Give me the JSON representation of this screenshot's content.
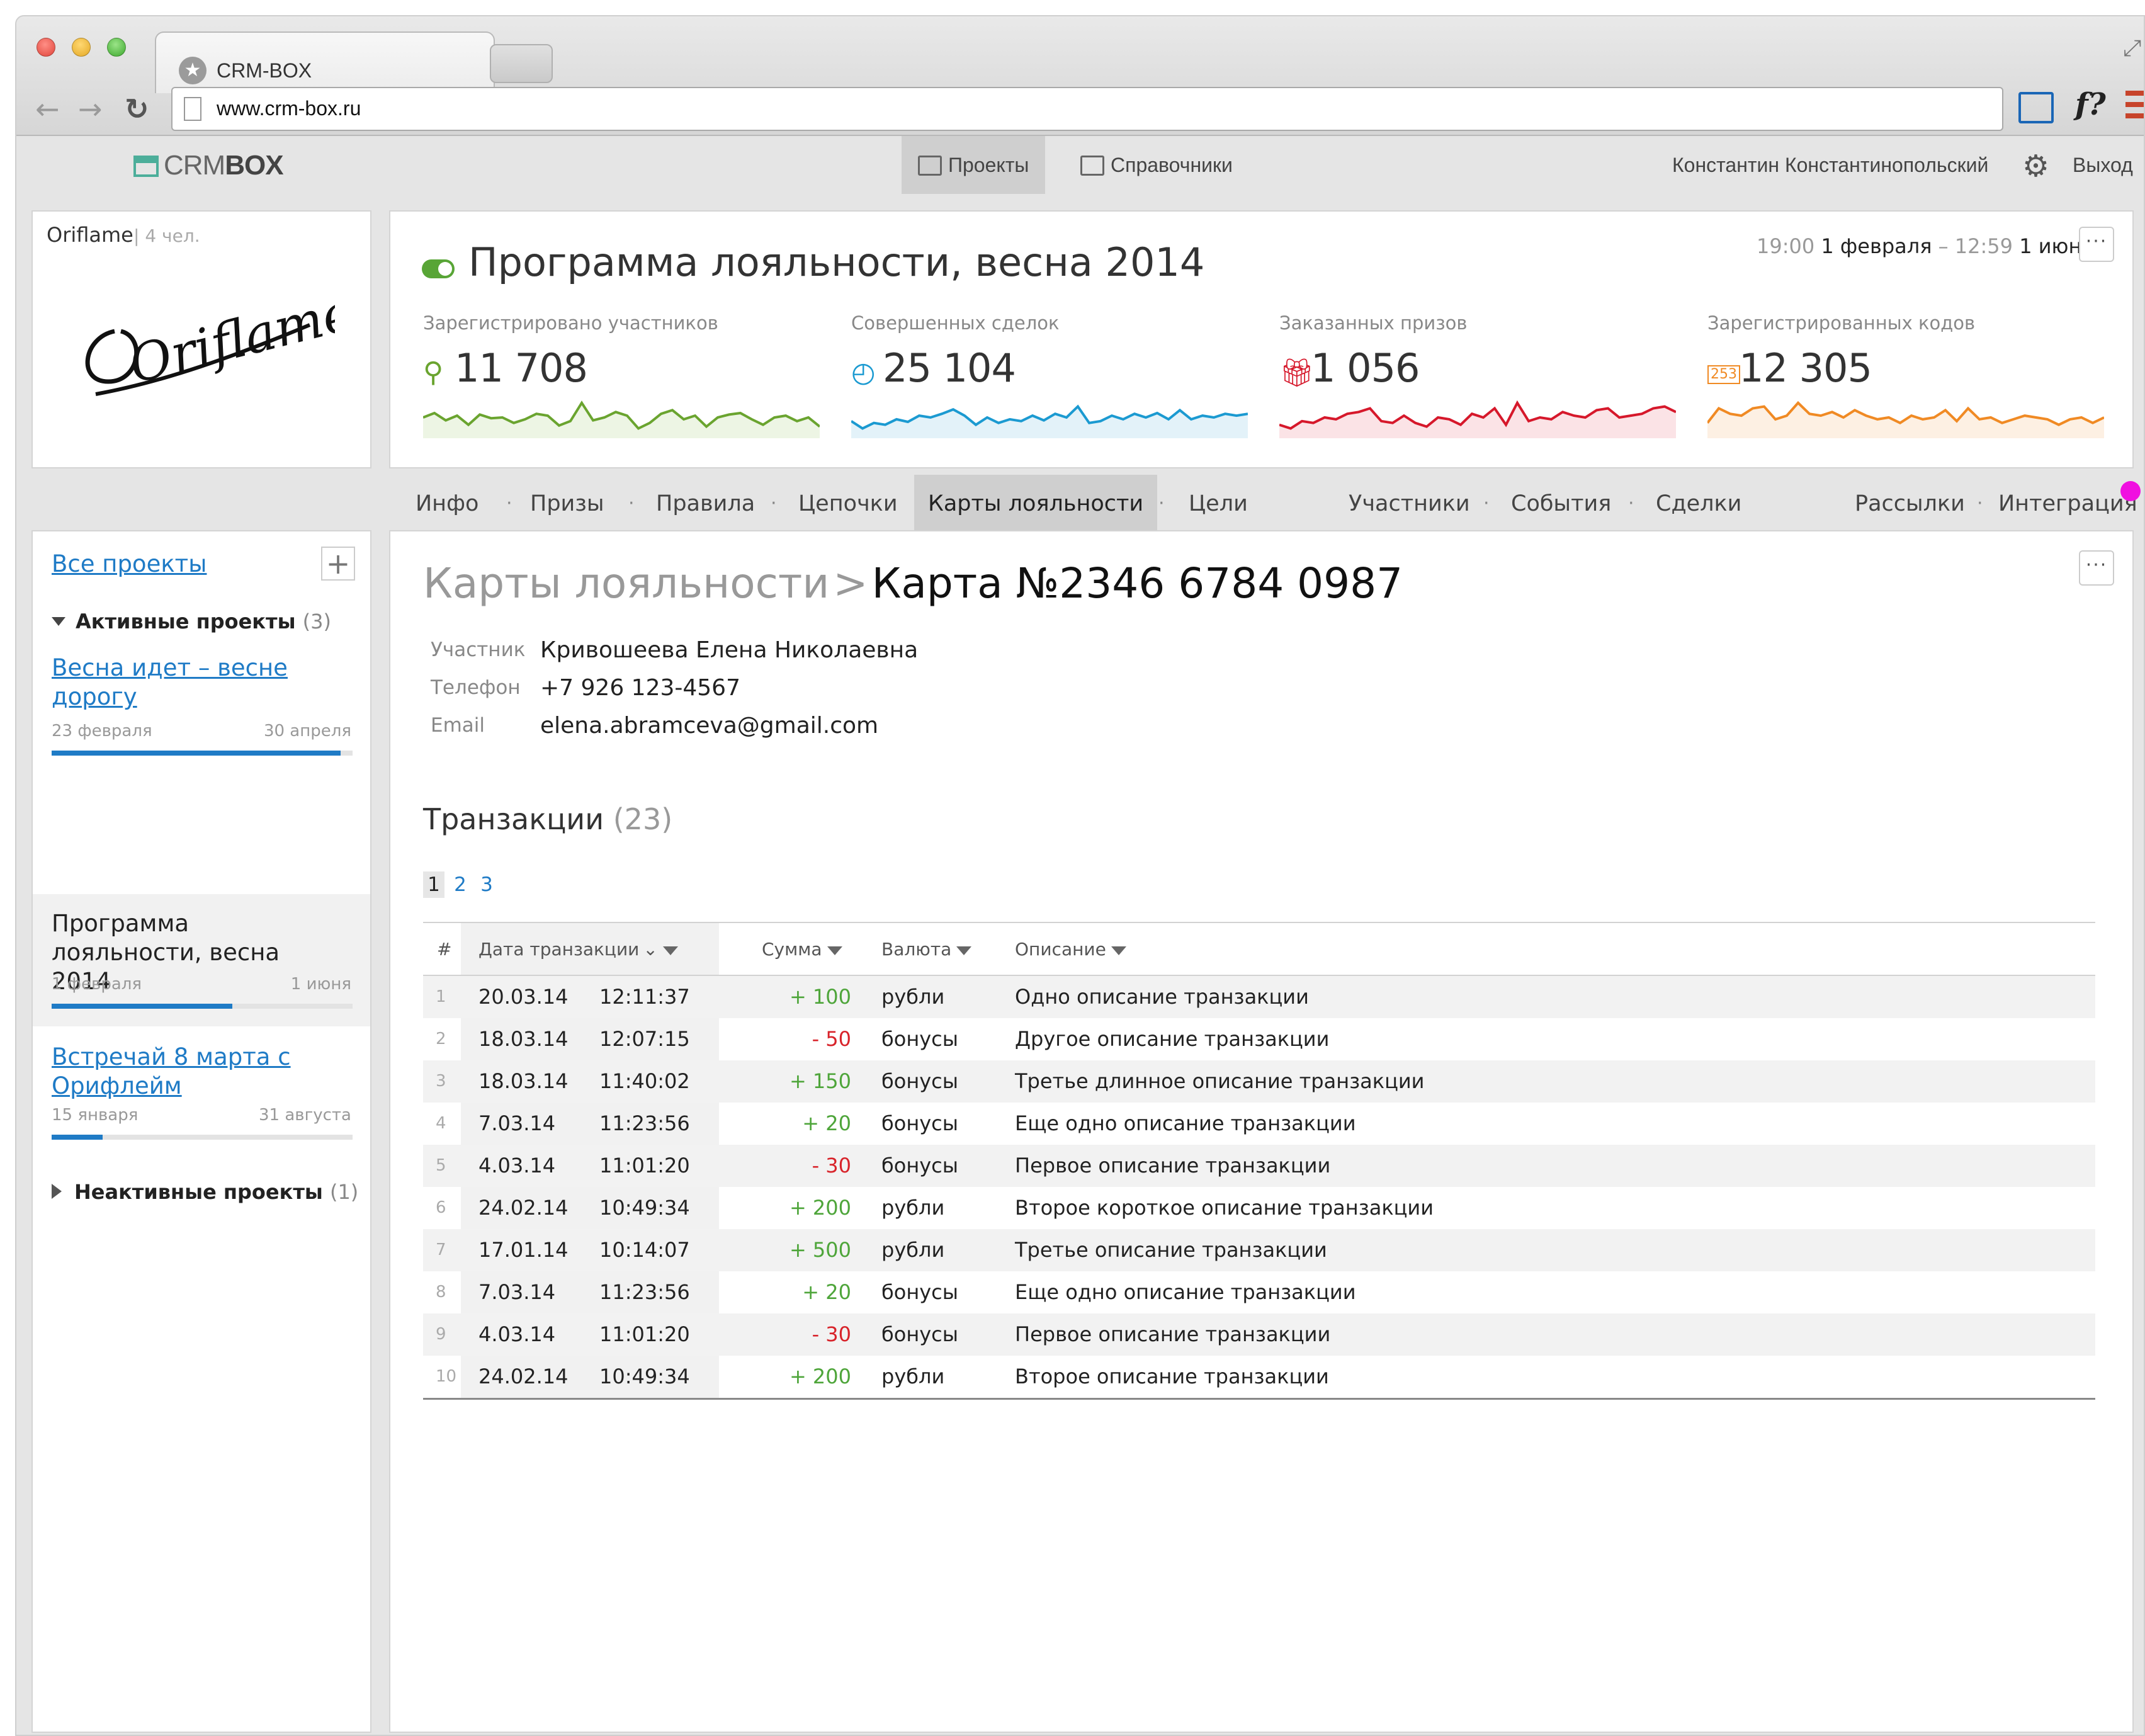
{
  "browser": {
    "tab_title": "CRM-BOX",
    "url": "www.crm-box.ru"
  },
  "appbar": {
    "logo_light": "CRM",
    "logo_bold": "BOX",
    "nav_projects": "Проекты",
    "nav_refs": "Справочники",
    "user_name": "Константин Константинопольский",
    "logout": "Выход"
  },
  "company": {
    "name": "Oriflame",
    "size": "| 4 чел.",
    "logo_text": "Oriflame"
  },
  "project": {
    "title": "Программа лояльности, весна 2014",
    "date_start_time": "19:00",
    "date_start": "1 февраля",
    "date_dash": "–",
    "date_end_time": "12:59",
    "date_end": "1 июня",
    "more": "···",
    "stats": [
      {
        "label": "Зарегистрировано участников",
        "value": "11 708",
        "icon": "user-icon",
        "color": "#6aa42f",
        "fill": "#edf5e4",
        "trend": [
          0.5,
          0.62,
          0.42,
          0.55,
          0.3,
          0.58,
          0.48,
          0.5,
          0.35,
          0.45,
          0.6,
          0.55,
          0.28,
          0.4,
          0.9,
          0.42,
          0.5,
          0.65,
          0.55,
          0.2,
          0.35,
          0.6,
          0.7,
          0.45,
          0.55,
          0.25,
          0.5,
          0.58,
          0.62,
          0.45,
          0.3,
          0.5,
          0.55,
          0.4,
          0.5,
          0.25
        ]
      },
      {
        "label": "Совершенных сделок",
        "value": "25 104",
        "icon": "clock-icon",
        "color": "#1b9ad1",
        "fill": "#e3f2f9",
        "trend": [
          0.4,
          0.2,
          0.35,
          0.3,
          0.45,
          0.38,
          0.55,
          0.5,
          0.6,
          0.72,
          0.55,
          0.3,
          0.5,
          0.35,
          0.45,
          0.4,
          0.55,
          0.42,
          0.6,
          0.5,
          0.8,
          0.35,
          0.4,
          0.55,
          0.45,
          0.6,
          0.5,
          0.62,
          0.45,
          0.7,
          0.45,
          0.55,
          0.5,
          0.6,
          0.55,
          0.6
        ]
      },
      {
        "label": "Заказанных призов",
        "value": "1 056",
        "icon": "gift-icon",
        "color": "#d6182b",
        "fill": "#fbe3e6",
        "trend": [
          0.3,
          0.2,
          0.4,
          0.35,
          0.5,
          0.45,
          0.6,
          0.65,
          0.75,
          0.4,
          0.35,
          0.55,
          0.35,
          0.25,
          0.5,
          0.45,
          0.3,
          0.6,
          0.5,
          0.75,
          0.3,
          0.9,
          0.4,
          0.5,
          0.45,
          0.65,
          0.55,
          0.5,
          0.7,
          0.75,
          0.5,
          0.55,
          0.6,
          0.75,
          0.8,
          0.65
        ]
      },
      {
        "label": "Зарегистрированных кодов",
        "value": "12 305",
        "icon": "code-icon",
        "color": "#f08a24",
        "fill": "#fdf0e3",
        "trend": [
          0.35,
          0.75,
          0.6,
          0.55,
          0.75,
          0.8,
          0.45,
          0.55,
          0.9,
          0.6,
          0.55,
          0.65,
          0.5,
          0.7,
          0.55,
          0.45,
          0.5,
          0.35,
          0.55,
          0.45,
          0.5,
          0.7,
          0.4,
          0.75,
          0.45,
          0.5,
          0.35,
          0.45,
          0.55,
          0.5,
          0.45,
          0.3,
          0.45,
          0.5,
          0.35,
          0.5
        ]
      }
    ]
  },
  "subnav": {
    "items": [
      "Инфо",
      "Призы",
      "Правила",
      "Цепочки",
      "Карты лояльности",
      "Цели",
      "Участники",
      "События",
      "Сделки",
      "Рассылки",
      "Интеграция"
    ],
    "separator": "·",
    "active": "Карты лояльности"
  },
  "sidebar": {
    "all_projects": "Все проекты",
    "add": "+",
    "active_group": "Активные  проекты",
    "active_count": "(3)",
    "inactive_group": "Неактивные проекты",
    "inactive_count": "(1)",
    "projects": [
      {
        "name": "Весна идет – весне дорогу",
        "start": "23 февраля",
        "end": "30 апреля",
        "progress": 0.96,
        "current": false
      },
      {
        "name": "Программа лояльности, весна 2014",
        "start": "1 февраля",
        "end": "1 июня",
        "progress": 0.6,
        "current": true
      },
      {
        "name": "Встречай 8 марта с Орифлейм",
        "start": "15 января",
        "end": "31 августа",
        "progress": 0.17,
        "current": false
      }
    ]
  },
  "card": {
    "breadcrumb_parent": "Карты лояльности",
    "breadcrumb_sep": ">",
    "breadcrumb_current": "Карта №2346 6784 0987",
    "more": "···",
    "participant_label": "Участник",
    "participant": "Кривошеева Елена Николаевна",
    "phone_label": "Телефон",
    "phone": "+7 926 123-4567",
    "email_label": "Email",
    "email": "elena.abramceva@gmail.com"
  },
  "transactions": {
    "title": "Транзакции",
    "count": "(23)",
    "pages": [
      "1",
      "2",
      "3"
    ],
    "current_page": "1",
    "columns": {
      "num": "#",
      "date": "Дата транзакции",
      "amount": "Сумма",
      "currency": "Валюта",
      "description": "Описание"
    },
    "rows": [
      {
        "n": "1",
        "date": "20.03.14",
        "time": "12:11:37",
        "amount": "+ 100",
        "sign": "pos",
        "currency": "рубли",
        "desc": "Одно описание транзакции"
      },
      {
        "n": "2",
        "date": "18.03.14",
        "time": "12:07:15",
        "amount": "- 50",
        "sign": "neg",
        "currency": "бонусы",
        "desc": "Другое описание транзакции"
      },
      {
        "n": "3",
        "date": "18.03.14",
        "time": "11:40:02",
        "amount": "+ 150",
        "sign": "pos",
        "currency": "бонусы",
        "desc": "Третье длинное описание транзакции"
      },
      {
        "n": "4",
        "date": "7.03.14",
        "time": "11:23:56",
        "amount": "+ 20",
        "sign": "pos",
        "currency": "бонусы",
        "desc": "Еще одно описание транзакции"
      },
      {
        "n": "5",
        "date": "4.03.14",
        "time": "11:01:20",
        "amount": "- 30",
        "sign": "neg",
        "currency": "бонусы",
        "desc": "Первое описание транзакции"
      },
      {
        "n": "6",
        "date": "24.02.14",
        "time": "10:49:34",
        "amount": "+ 200",
        "sign": "pos",
        "currency": "рубли",
        "desc": "Второе короткое описание транзакции"
      },
      {
        "n": "7",
        "date": "17.01.14",
        "time": "10:14:07",
        "amount": "+ 500",
        "sign": "pos",
        "currency": "рубли",
        "desc": "Третье описание транзакции"
      },
      {
        "n": "8",
        "date": "7.03.14",
        "time": "11:23:56",
        "amount": "+ 20",
        "sign": "pos",
        "currency": "бонусы",
        "desc": "Еще одно описание транзакции"
      },
      {
        "n": "9",
        "date": "4.03.14",
        "time": "11:01:20",
        "amount": "- 30",
        "sign": "neg",
        "currency": "бонусы",
        "desc": "Первое описание транзакции"
      },
      {
        "n": "10",
        "date": "24.02.14",
        "time": "10:49:34",
        "amount": "+ 200",
        "sign": "pos",
        "currency": "рубли",
        "desc": "Второе описание транзакции"
      }
    ]
  }
}
